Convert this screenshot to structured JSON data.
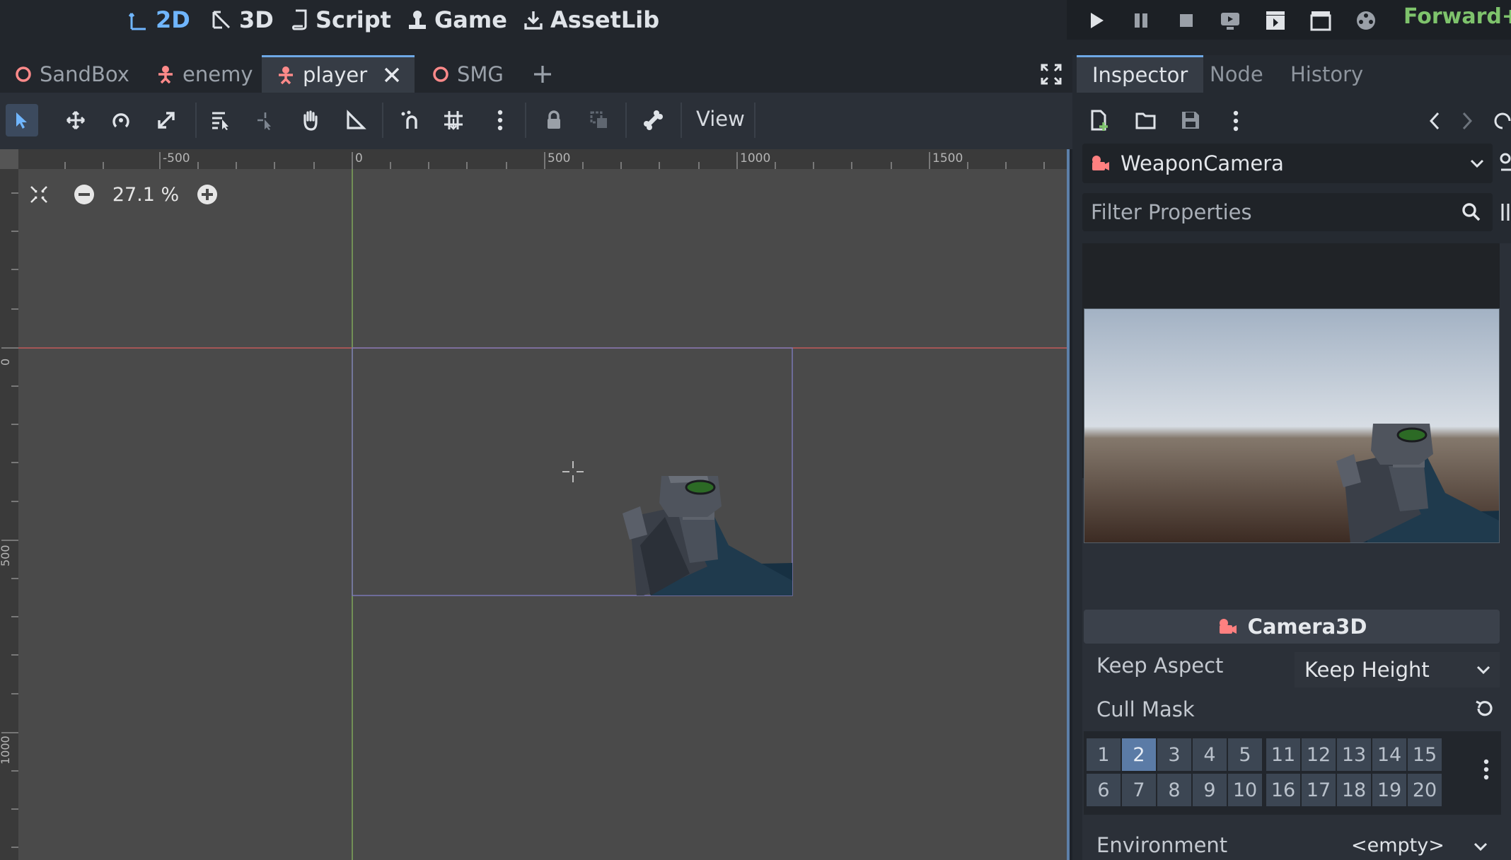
{
  "workspaces": [
    {
      "label": "2D",
      "icon": "2d-icon",
      "active": true
    },
    {
      "label": "3D",
      "icon": "3d-icon",
      "active": false
    },
    {
      "label": "Script",
      "icon": "script-icon",
      "active": false
    },
    {
      "label": "Game",
      "icon": "game-icon",
      "active": false
    },
    {
      "label": "AssetLib",
      "icon": "download-icon",
      "active": false
    }
  ],
  "renderer": "Forward+",
  "scene_tabs": [
    {
      "label": "SandBox",
      "icon": "node3d-circle-icon",
      "active": false
    },
    {
      "label": "enemy",
      "icon": "character-body-icon",
      "active": false
    },
    {
      "label": "player",
      "icon": "character-body-icon",
      "active": true
    },
    {
      "label": "SMG",
      "icon": "node3d-circle-icon",
      "active": false
    }
  ],
  "toolbar": {
    "view_label": "View"
  },
  "viewport": {
    "zoom": "27.1 %",
    "ruler_top": [
      "-500",
      "0",
      "500",
      "1000",
      "1500"
    ],
    "ruler_left": [
      "0",
      "500",
      "1000"
    ]
  },
  "dock_tabs": [
    {
      "label": "Inspector",
      "active": true
    },
    {
      "label": "Node",
      "active": false
    },
    {
      "label": "History",
      "active": false
    }
  ],
  "inspector": {
    "node_name": "WeaponCamera",
    "filter_placeholder": "Filter Properties",
    "section": "Camera3D",
    "keep_aspect_label": "Keep Aspect",
    "keep_aspect_value": "Keep Height",
    "cull_mask_label": "Cull Mask",
    "cull_mask_cells": [
      "1",
      "2",
      "3",
      "4",
      "5",
      "11",
      "12",
      "13",
      "14",
      "15",
      "6",
      "7",
      "8",
      "9",
      "10",
      "16",
      "17",
      "18",
      "19",
      "20"
    ],
    "cull_mask_on": [
      2
    ],
    "environment_label": "Environment",
    "environment_value": "<empty>"
  },
  "colors": {
    "accent": "#70b6ff",
    "renderer": "#7ec36c",
    "node_icon": "#ff8080"
  }
}
